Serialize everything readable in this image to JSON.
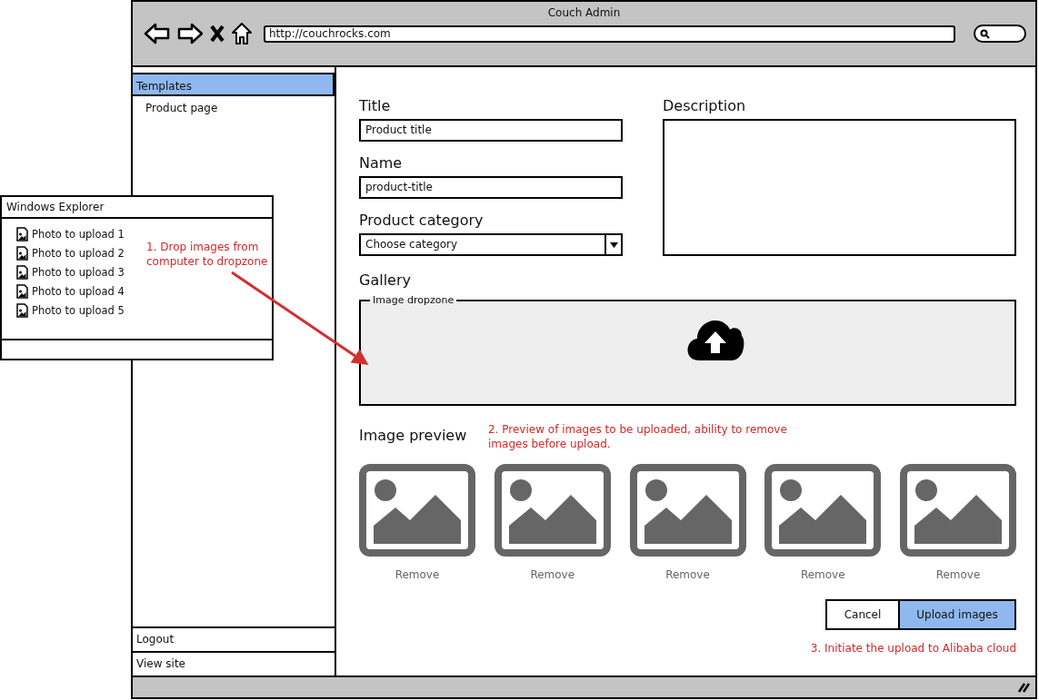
{
  "window": {
    "title": "Couch Admin"
  },
  "toolbar": {
    "url": "http://couchrocks.com"
  },
  "sidebar": {
    "items": [
      {
        "label": "Templates",
        "selected": true,
        "children": [
          {
            "label": "Product page",
            "selected": false
          }
        ]
      }
    ],
    "footer_items": [
      {
        "label": "Logout"
      },
      {
        "label": "View site"
      }
    ]
  },
  "form": {
    "title": {
      "label": "Title",
      "value": "Product title"
    },
    "name": {
      "label": "Name",
      "value": "product-title"
    },
    "category": {
      "label": "Product category",
      "value": "Choose category"
    },
    "description": {
      "label": "Description"
    }
  },
  "gallery": {
    "heading": "Gallery",
    "dropzone": "Image dropzone"
  },
  "preview": {
    "heading": "Image preview",
    "note": "2. Preview of images to be uploaded, ability to remove images before upload.",
    "items": [
      {
        "kind": "picture",
        "action": "Remove"
      },
      {
        "kind": "picture",
        "action": "Remove"
      },
      {
        "kind": "picture",
        "action": "Remove"
      },
      {
        "kind": "picture",
        "action": "Remove"
      },
      {
        "kind": "picture",
        "action": "Remove"
      }
    ]
  },
  "buttons": [
    {
      "label": "Cancel",
      "primary": false
    },
    {
      "label": "Upload images",
      "primary": true
    }
  ],
  "upload_note": "3. Initiate the upload to Alibaba cloud",
  "explorer": {
    "title": "Windows Explorer",
    "files": [
      "Photo to upload 1",
      "Photo to upload 2",
      "Photo to upload 3",
      "Photo to upload 4",
      "Photo to upload 5"
    ],
    "note": "1. Drop images from computer to dropzone"
  }
}
